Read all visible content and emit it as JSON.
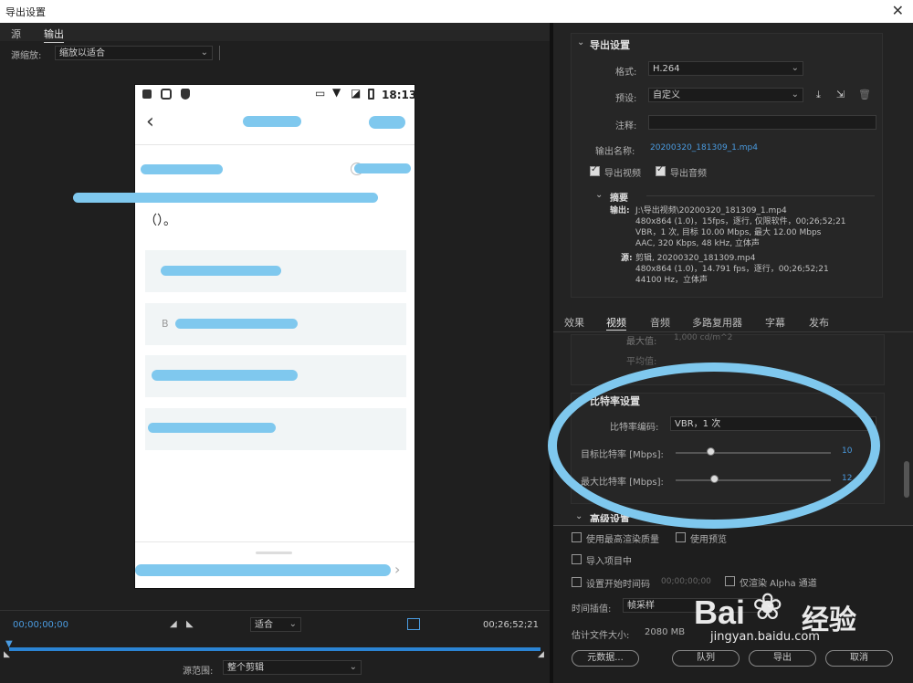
{
  "title": "导出设置",
  "close": "✕",
  "left_tabs": [
    "源",
    "输出"
  ],
  "scale_label": "源缩放:",
  "scale_value": "缩放以适合",
  "phone": {
    "time": "18:13",
    "back": "‹",
    "paren_text": "（）。",
    "opt_b": "B"
  },
  "export": {
    "section": "导出设置",
    "format_label": "格式:",
    "format_value": "H.264",
    "preset_label": "预设:",
    "preset_value": "自定义",
    "comment_label": "注释:",
    "output_name_label": "输出名称:",
    "output_name_value": "20200320_181309_1.mp4",
    "export_video": "导出视频",
    "export_audio": "导出音频",
    "summary": "摘要",
    "output_label": "输出:",
    "output_lines": [
      "J:\\导出视频\\20200320_181309_1.mp4",
      "480x864 (1.0)，15fps，逐行, 仅限软件，00;26;52;21",
      "VBR，1 次, 目标 10.00 Mbps, 最大 12.00 Mbps",
      "AAC, 320 Kbps, 48  kHz, 立体声"
    ],
    "source_label": "源:",
    "source_lines": [
      "剪辑, 20200320_181309.mp4",
      "480x864 (1.0)，14.791 fps，逐行，00;26;52;21",
      "44100 Hz，立体声"
    ]
  },
  "tabs2": [
    "效果",
    "视频",
    "音频",
    "多路复用器",
    "字幕",
    "发布"
  ],
  "video": {
    "max_label": "最大值:",
    "max_value": "1,000 cd/m^2",
    "avg_label": "平均值:"
  },
  "bitrate": {
    "section": "比特率设置",
    "encoding_label": "比特率编码:",
    "encoding_value": "VBR，1 次",
    "target_label": "目标比特率 [Mbps]:",
    "target_value": "10",
    "max_label": "最大比特率 [Mbps]:",
    "max_value": "12",
    "target_level": 0.23,
    "max_level": 0.25
  },
  "advanced": "高级设置",
  "bottom": {
    "max_quality": "使用最高渲染质量",
    "use_preview": "使用预览",
    "import": "导入项目中",
    "start_tc": "设置开始时间码",
    "start_tc_value": "00;00;00;00",
    "alpha": "仅渲染 Alpha 通道",
    "interp_label": "时间插值:",
    "interp_value": "帧采样",
    "filesize_label": "估计文件大小:",
    "filesize_value": "2080 MB",
    "metadata": "元数据...",
    "queue": "队列",
    "export": "导出",
    "cancel": "取消"
  },
  "timeline": {
    "tc_start": "00;00;00;00",
    "fit": "适合",
    "tc_end": "00;26;52;21",
    "range_label": "源范围:",
    "range_value": "整个剪辑"
  },
  "watermark": {
    "brand": "Bai",
    "brand2": "经验",
    "url": "jingyan.baidu.com"
  }
}
